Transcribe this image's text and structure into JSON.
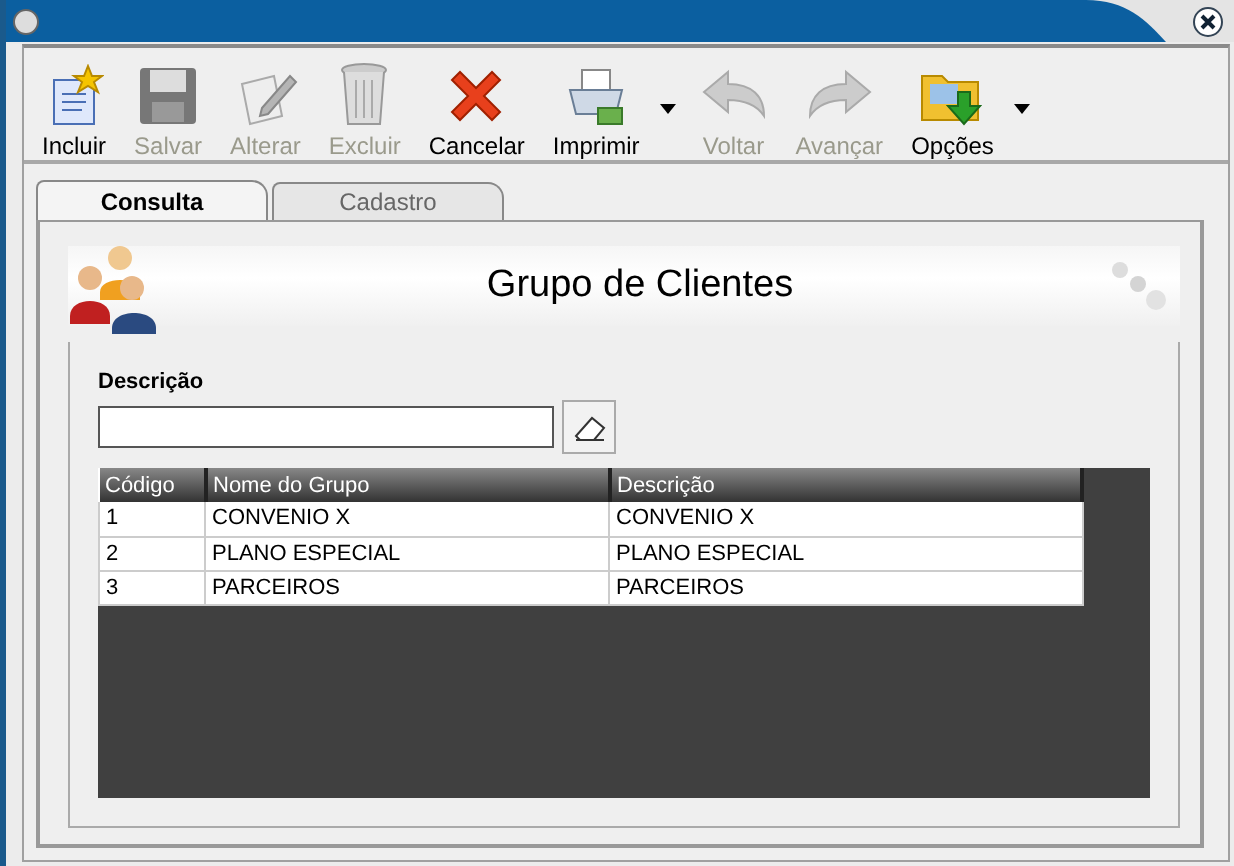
{
  "toolbar": [
    {
      "label": "Incluir",
      "kind": "new",
      "disabled": false,
      "dropdown": false
    },
    {
      "label": "Salvar",
      "kind": "save",
      "disabled": true,
      "dropdown": false
    },
    {
      "label": "Alterar",
      "kind": "edit",
      "disabled": true,
      "dropdown": false
    },
    {
      "label": "Excluir",
      "kind": "trash",
      "disabled": true,
      "dropdown": false
    },
    {
      "label": "Cancelar",
      "kind": "cancel",
      "disabled": false,
      "dropdown": false
    },
    {
      "label": "Imprimir",
      "kind": "print",
      "disabled": false,
      "dropdown": true
    },
    {
      "label": "Voltar",
      "kind": "back",
      "disabled": true,
      "dropdown": false
    },
    {
      "label": "Avançar",
      "kind": "forward",
      "disabled": true,
      "dropdown": false
    },
    {
      "label": "Opções",
      "kind": "options",
      "disabled": false,
      "dropdown": true
    }
  ],
  "tabs": [
    {
      "label": "Consulta",
      "selected": true
    },
    {
      "label": "Cadastro",
      "selected": false
    }
  ],
  "header": {
    "title": "Grupo de Clientes"
  },
  "filter": {
    "label": "Descrição"
  },
  "table": {
    "columns": [
      "Código",
      "Nome do Grupo",
      "Descrição"
    ],
    "rows": [
      [
        "1",
        "CONVENIO X",
        "CONVENIO X"
      ],
      [
        "2",
        "PLANO ESPECIAL",
        "PLANO ESPECIAL"
      ],
      [
        "3",
        "PARCEIROS",
        "PARCEIROS"
      ]
    ]
  }
}
